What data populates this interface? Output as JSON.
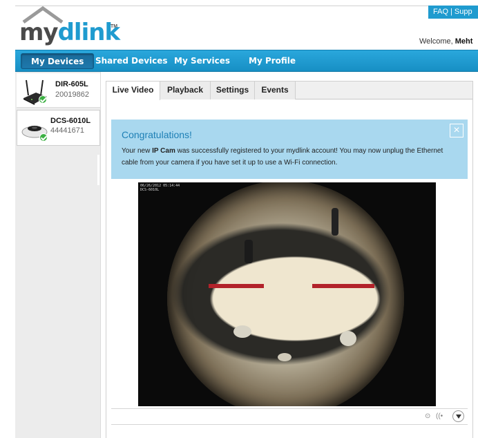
{
  "header": {
    "logo_my": "my",
    "logo_dlink": "dlink",
    "logo_tm": "TM",
    "faq_label": "FAQ",
    "faq_sep": "|",
    "support_label": "Supp",
    "welcome_prefix": "Welcome,",
    "welcome_user": "Meht"
  },
  "nav": {
    "items": [
      {
        "label": "My Devices"
      },
      {
        "label": "Shared Devices"
      },
      {
        "label": "My Services"
      },
      {
        "label": "My Profile"
      }
    ]
  },
  "sidebar": {
    "devices": [
      {
        "name": "DIR-605L",
        "id": "20019862",
        "icon": "router-icon",
        "status": "online"
      },
      {
        "name": "DCS-6010L",
        "id": "44441671",
        "icon": "camera-icon",
        "status": "online"
      }
    ]
  },
  "main": {
    "tabs": [
      {
        "label": "Live Video"
      },
      {
        "label": "Playback"
      },
      {
        "label": "Settings"
      },
      {
        "label": "Events"
      }
    ],
    "alert": {
      "title": "Congratulations!",
      "body_prefix": "Your new ",
      "body_bold": "IP Cam",
      "body_rest": " was successfully registered to your mydlink account! You may now unplug the Ethernet cable from your camera if you have set it up to use a Wi-Fi connection.",
      "close_glyph": "×"
    },
    "video": {
      "overlay_timestamp": "06/26/2012 05:14:44",
      "overlay_camera": "DCS-6010L"
    },
    "controls": {
      "record_glyph": "⊙",
      "audio_glyph": "((•",
      "menu_icon": "chevron-down-icon"
    }
  },
  "colors": {
    "brand_blue": "#1f9bcf",
    "alert_bg": "#a9d8ef",
    "status_green": "#3cb043"
  }
}
